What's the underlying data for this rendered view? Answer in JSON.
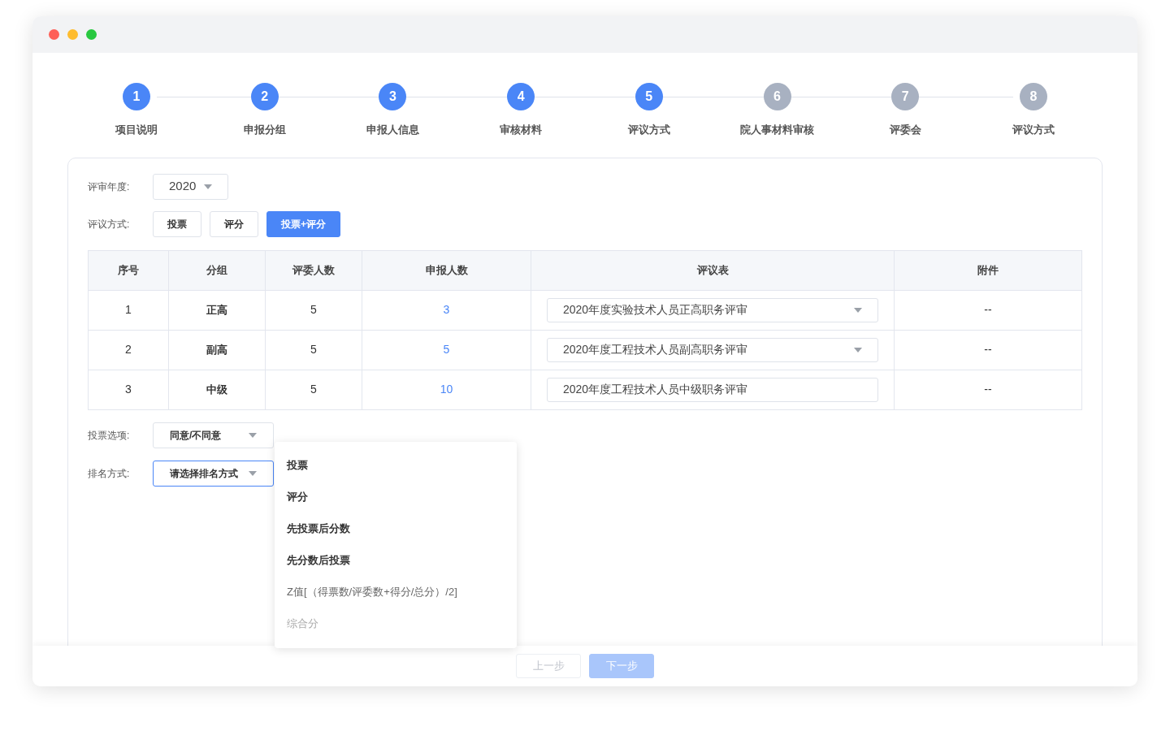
{
  "steps": [
    {
      "number": "1",
      "label": "项目说明",
      "reached": true
    },
    {
      "number": "2",
      "label": "申报分组",
      "reached": true
    },
    {
      "number": "3",
      "label": "申报人信息",
      "reached": true
    },
    {
      "number": "4",
      "label": "审核材料",
      "reached": true
    },
    {
      "number": "5",
      "label": "评议方式",
      "reached": true
    },
    {
      "number": "6",
      "label": "院人事材料审核",
      "reached": false
    },
    {
      "number": "7",
      "label": "评委会",
      "reached": false
    },
    {
      "number": "8",
      "label": "评议方式",
      "reached": false
    }
  ],
  "year": {
    "label": "评审年度:",
    "value": "2020"
  },
  "method": {
    "label": "评议方式:",
    "options": [
      {
        "label": "投票",
        "selected": false
      },
      {
        "label": "评分",
        "selected": false
      },
      {
        "label": "投票+评分",
        "selected": true
      }
    ]
  },
  "table": {
    "columns": [
      "序号",
      "分组",
      "评委人数",
      "申报人数",
      "评议表",
      "附件"
    ],
    "rows": [
      {
        "index": "1",
        "group": "正高",
        "judges": "5",
        "applicants": "3",
        "form": "2020年度实验技术人员正高职务评审",
        "kind": "select",
        "attachment": "--"
      },
      {
        "index": "2",
        "group": "副高",
        "judges": "5",
        "applicants": "5",
        "form": "2020年度工程技术人员副高职务评审",
        "kind": "select",
        "attachment": "--"
      },
      {
        "index": "3",
        "group": "中级",
        "judges": "5",
        "applicants": "10",
        "form": "2020年度工程技术人员中级职务评审",
        "kind": "text",
        "attachment": "--"
      }
    ]
  },
  "vote_option": {
    "label": "投票选项:",
    "value": "同意/不同意",
    "focused": false
  },
  "ranking": {
    "label": "排名方式:",
    "placeholder": "请选择排名方式",
    "focused": true,
    "menu": [
      {
        "label": "投票",
        "kind": "strong"
      },
      {
        "label": "评分",
        "kind": "strong"
      },
      {
        "label": "先投票后分数",
        "kind": "strong"
      },
      {
        "label": "先分数后投票",
        "kind": "strong"
      },
      {
        "label": "Z值[（得票数/评委数+得分/总分）/2]",
        "kind": "plain"
      },
      {
        "label": "综合分",
        "kind": "disabled"
      }
    ]
  },
  "footer": [
    {
      "label": "上一步",
      "kind": "default",
      "disabled": true
    },
    {
      "label": "下一步",
      "kind": "primary",
      "disabled": true
    }
  ]
}
